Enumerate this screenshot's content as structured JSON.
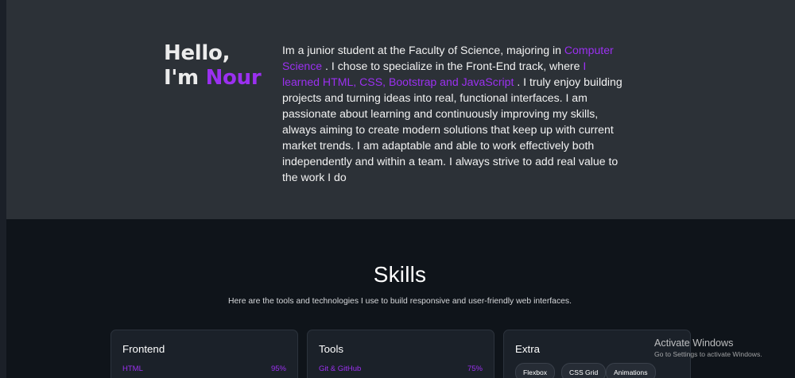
{
  "about": {
    "greeting_line1": "Hello,",
    "greeting_prefix": "I'm",
    "greeting_name": "Nour",
    "text_1": "Im a junior student at the Faculty of Science, majoring in ",
    "highlight_1": "Computer Science",
    "text_2": " . I chose to specialize in the Front-End track, where ",
    "highlight_2": "I learned HTML, CSS, Bootstrap and JavaScript",
    "text_3": " . I truly enjoy building projects and turning ideas into real, functional interfaces. I am passionate about learning and continuously improving my skills, always aiming to create modern solutions that keep up with current market trends. I am adaptable and able to work effectively both independently and within a team. I always strive to add real value to the work I do"
  },
  "skills": {
    "title": "Skills",
    "subtitle": "Here are the tools and technologies I use to build responsive and user-friendly web interfaces.",
    "cards": [
      {
        "title": "Frontend",
        "first_skill": "HTML",
        "first_value": "95%"
      },
      {
        "title": "Tools",
        "first_skill": "Git & GitHub",
        "first_value": "75%"
      },
      {
        "title": "Extra",
        "chips": [
          "Flexbox",
          "CSS Grid",
          "Animations"
        ]
      }
    ]
  },
  "watermark": {
    "title": "Activate Windows",
    "subtitle": "Go to Settings to activate Windows."
  },
  "colors": {
    "accent": "#9b30f0",
    "about_bg": "#2c3137",
    "skills_bg": "#0f141a",
    "card_bg": "#1b2129"
  }
}
